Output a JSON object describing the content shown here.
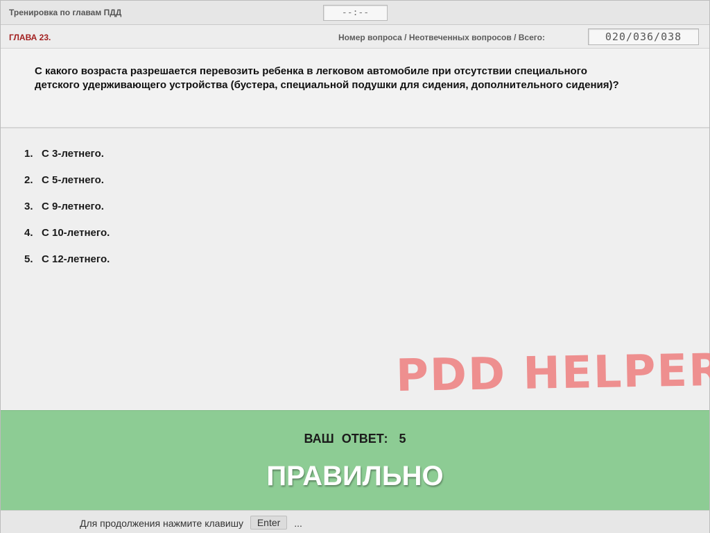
{
  "header": {
    "title": "Тренировка по главам ПДД",
    "timer": "--:--"
  },
  "chapter_bar": {
    "chapter": "ГЛАВА 23.",
    "counter_label": "Номер вопроса / Неотвеченных вопросов / Всего:",
    "counter": "020/036/038"
  },
  "question": {
    "text": "С какого возраста разрешается перевозить ребенка в легковом автомобиле при отсутствии специального детского удерживающего устройства (бустера, специальной подушки для сидения, дополнительного сидения)?"
  },
  "answers": [
    {
      "num": "1.",
      "text": "С 3-летнего."
    },
    {
      "num": "2.",
      "text": "С 5-летнего."
    },
    {
      "num": "3.",
      "text": "С 9-летнего."
    },
    {
      "num": "4.",
      "text": "С 10-летнего."
    },
    {
      "num": "5.",
      "text": "С 12-летнего."
    }
  ],
  "watermark": "PDD HELPER",
  "result": {
    "your_answer_label": "ВАШ ОТВЕТ:",
    "your_answer_value": "5",
    "verdict": "ПРАВИЛЬНО",
    "status_color": "#8dcc94"
  },
  "footer": {
    "hint_prefix": "Для продолжения нажмите клавишу",
    "key": "Enter",
    "hint_suffix": "..."
  }
}
